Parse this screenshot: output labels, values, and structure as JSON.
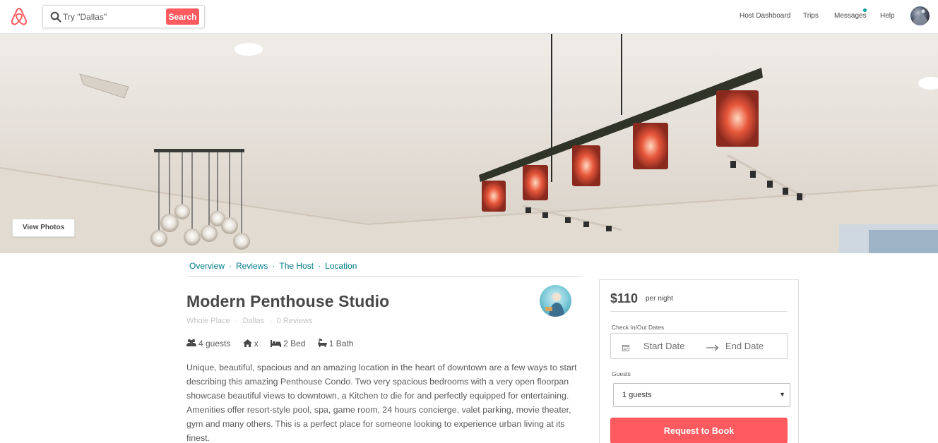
{
  "colors": {
    "brand": "#ff5a5f",
    "link": "#007a87",
    "notification": "#00a699"
  },
  "header": {
    "search_placeholder": "Try \"Dallas\"",
    "search_button": "Search",
    "nav": [
      "Host Dashboard",
      "Trips",
      "Messages",
      "Help"
    ]
  },
  "hero": {
    "view_photos": "View Photos"
  },
  "subnav": {
    "items": [
      "Overview",
      "Reviews",
      "The Host",
      "Location"
    ],
    "separator": "·"
  },
  "listing": {
    "title": "Modern Penthouse Studio",
    "place_type": "Whole Place",
    "city": "Dallas",
    "reviews": "0 Reviews",
    "amenities": [
      {
        "icon": "guests-icon",
        "text": "4 guests"
      },
      {
        "icon": "home-icon",
        "text": "x"
      },
      {
        "icon": "bed-icon",
        "text": "2 Bed"
      },
      {
        "icon": "bath-icon",
        "text": "1 Bath"
      }
    ],
    "description": "Unique, beautiful, spacious and an amazing location in the heart of downtown are a few ways to start describing this amazing Penthouse Condo. Two very spacious bedrooms with a very open floorpan showcase beautiful views to downtown, a Kitchen to die for and perfectly equipped for entertaining. Amenities offer resort-style pool, spa, game room, 24 hours concierge, valet parking, movie theater, gym and many others. This is a perfect place for someone looking to experience urban living at its finest."
  },
  "booking": {
    "price": "$110",
    "per_night": "per night",
    "dates_label": "Check In/Out Dates",
    "start_date": "Start Date",
    "end_date": "End Date",
    "guests_label": "Guests",
    "guests_value": "1 guests",
    "request_button": "Request to Book"
  }
}
